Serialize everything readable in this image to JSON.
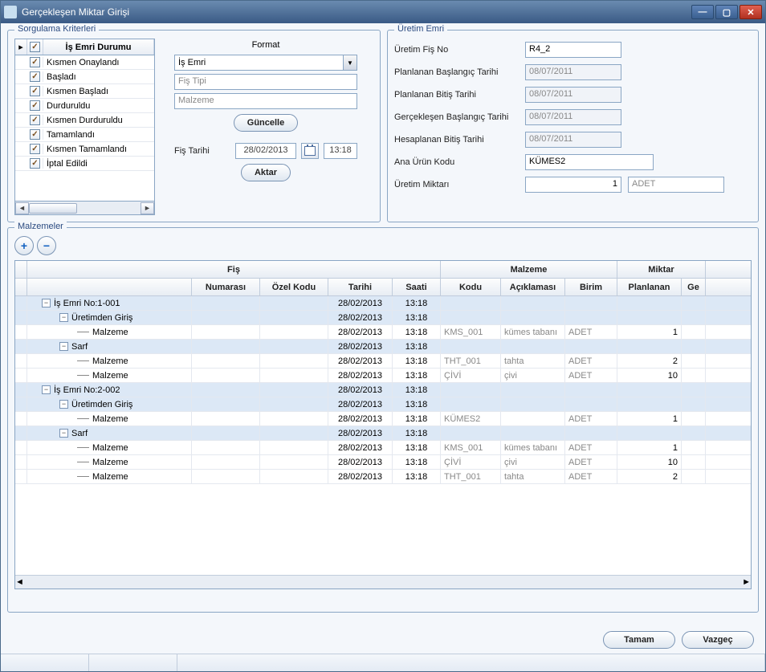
{
  "window": {
    "title": "Gerçekleşen Miktar Girişi"
  },
  "sorgulama": {
    "legend": "Sorgulama Kriterleri",
    "status_header": "İş Emri Durumu",
    "statuses": [
      "Kısmen Onaylandı",
      "Başladı",
      "Kısmen Başladı",
      "Durduruldu",
      "Kısmen Durduruldu",
      "Tamamlandı",
      "Kısmen Tamamlandı",
      "İptal Edildi"
    ],
    "format_label": "Format",
    "format_select": "İş Emri",
    "fis_tipi_label": "Fiş Tipi",
    "malzeme_label": "Malzeme",
    "guncelle": "Güncelle",
    "fis_tarihi_label": "Fiş Tarihi",
    "fis_tarihi": "28/02/2013",
    "fis_saat": "13:18",
    "aktar": "Aktar"
  },
  "uretim": {
    "legend": "Üretim Emri",
    "fisno_label": "Üretim Fiş No",
    "fisno": "R4_2",
    "planbas_label": "Planlanan Başlangıç Tarihi",
    "planbas": "08/07/2011",
    "planbit_label": "Planlanan Bitiş Tarihi",
    "planbit": "08/07/2011",
    "gerbas_label": "Gerçekleşen Başlangıç Tarihi",
    "gerbas": "08/07/2011",
    "hesbit_label": "Hesaplanan Bitiş Tarihi",
    "hesbit": "08/07/2011",
    "anakod_label": "Ana Ürün Kodu",
    "anakod": "KÜMES2",
    "miktar_label": "Üretim Miktarı",
    "miktar": "1",
    "birim": "ADET"
  },
  "malzemeler": {
    "legend": "Malzemeler",
    "group_fis": "Fiş",
    "group_malzeme": "Malzeme",
    "group_miktar": "Miktar",
    "h_num": "Numarası",
    "h_ozel": "Özel Kodu",
    "h_tarih": "Tarihi",
    "h_saat": "Saati",
    "h_kodu": "Kodu",
    "h_acik": "Açıklaması",
    "h_birim": "Birim",
    "h_plan": "Planlanan",
    "h_ge": "Ge",
    "rows": [
      {
        "lvl": 0,
        "kind": "blue",
        "tree": "İş Emri No:1-001",
        "tarih": "28/02/2013",
        "saat": "13:18"
      },
      {
        "lvl": 1,
        "kind": "blue",
        "tree": "Üretimden Giriş",
        "tarih": "28/02/2013",
        "saat": "13:18"
      },
      {
        "lvl": 2,
        "kind": "white",
        "tree": "Malzeme",
        "tarih": "28/02/2013",
        "saat": "13:18",
        "kodu": "KMS_001",
        "acik": "kümes tabanı",
        "birim": "ADET",
        "plan": "1"
      },
      {
        "lvl": 1,
        "kind": "blue",
        "tree": "Sarf",
        "tarih": "28/02/2013",
        "saat": "13:18"
      },
      {
        "lvl": 2,
        "kind": "white",
        "tree": "Malzeme",
        "tarih": "28/02/2013",
        "saat": "13:18",
        "kodu": "THT_001",
        "acik": "tahta",
        "birim": "ADET",
        "plan": "2"
      },
      {
        "lvl": 2,
        "kind": "white",
        "tree": "Malzeme",
        "tarih": "28/02/2013",
        "saat": "13:18",
        "kodu": "ÇİVİ",
        "acik": "çivi",
        "birim": "ADET",
        "plan": "10"
      },
      {
        "lvl": 0,
        "kind": "blue",
        "tree": "İş Emri No:2-002",
        "tarih": "28/02/2013",
        "saat": "13:18"
      },
      {
        "lvl": 1,
        "kind": "blue",
        "tree": "Üretimden Giriş",
        "tarih": "28/02/2013",
        "saat": "13:18"
      },
      {
        "lvl": 2,
        "kind": "white",
        "tree": "Malzeme",
        "tarih": "28/02/2013",
        "saat": "13:18",
        "kodu": "KÜMES2",
        "acik": "",
        "birim": "ADET",
        "plan": "1"
      },
      {
        "lvl": 1,
        "kind": "blue",
        "tree": "Sarf",
        "tarih": "28/02/2013",
        "saat": "13:18"
      },
      {
        "lvl": 2,
        "kind": "white",
        "tree": "Malzeme",
        "tarih": "28/02/2013",
        "saat": "13:18",
        "kodu": "KMS_001",
        "acik": "kümes tabanı",
        "birim": "ADET",
        "plan": "1"
      },
      {
        "lvl": 2,
        "kind": "white",
        "tree": "Malzeme",
        "tarih": "28/02/2013",
        "saat": "13:18",
        "kodu": "ÇİVİ",
        "acik": "çivi",
        "birim": "ADET",
        "plan": "10"
      },
      {
        "lvl": 2,
        "kind": "white",
        "tree": "Malzeme",
        "tarih": "28/02/2013",
        "saat": "13:18",
        "kodu": "THT_001",
        "acik": "tahta",
        "birim": "ADET",
        "plan": "2"
      }
    ]
  },
  "footer": {
    "tamam": "Tamam",
    "vazgec": "Vazgeç"
  }
}
